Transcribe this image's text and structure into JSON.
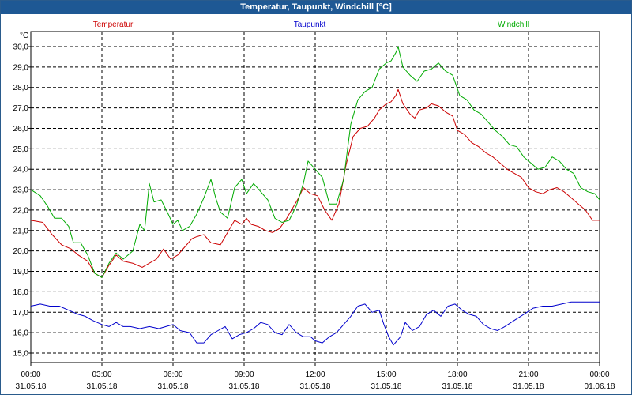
{
  "window": {
    "title": "Temperatur, Taupunkt, Windchill [°C]"
  },
  "chart_data": {
    "type": "line",
    "title": "Temperatur, Taupunkt, Windchill [°C]",
    "ylabel": "°C",
    "ylim": [
      14.6,
      30.6
    ],
    "yticks": [
      "15,0",
      "16,0",
      "17,0",
      "18,0",
      "19,0",
      "20,0",
      "21,0",
      "22,0",
      "23,0",
      "24,0",
      "25,0",
      "26,0",
      "27,0",
      "28,0",
      "29,0",
      "30,0"
    ],
    "ytick_values": [
      15,
      16,
      17,
      18,
      19,
      20,
      21,
      22,
      23,
      24,
      25,
      26,
      27,
      28,
      29,
      30
    ],
    "xlim": [
      0,
      24
    ],
    "xticks": [
      {
        "hour": 0,
        "time": "00:00",
        "date": "31.05.18"
      },
      {
        "hour": 3,
        "time": "03:00",
        "date": "31.05.18"
      },
      {
        "hour": 6,
        "time": "06:00",
        "date": "31.05.18"
      },
      {
        "hour": 9,
        "time": "09:00",
        "date": "31.05.18"
      },
      {
        "hour": 12,
        "time": "12:00",
        "date": "31.05.18"
      },
      {
        "hour": 15,
        "time": "15:00",
        "date": "31.05.18"
      },
      {
        "hour": 18,
        "time": "18:00",
        "date": "31.05.18"
      },
      {
        "hour": 21,
        "time": "21:00",
        "date": "31.05.18"
      },
      {
        "hour": 24,
        "time": "00:00",
        "date": "01.06.18"
      }
    ],
    "grid": true,
    "legend_position": "top",
    "series": [
      {
        "name": "Temperatur",
        "color": "#cc0000",
        "points": [
          [
            0,
            21.5
          ],
          [
            0.5,
            21.4
          ],
          [
            0.9,
            20.8
          ],
          [
            1.3,
            20.3
          ],
          [
            1.7,
            20.1
          ],
          [
            2.0,
            19.8
          ],
          [
            2.4,
            19.5
          ],
          [
            2.7,
            18.9
          ],
          [
            3.0,
            18.7
          ],
          [
            3.3,
            19.3
          ],
          [
            3.6,
            19.8
          ],
          [
            3.9,
            19.5
          ],
          [
            4.3,
            19.4
          ],
          [
            4.7,
            19.2
          ],
          [
            5.0,
            19.4
          ],
          [
            5.3,
            19.6
          ],
          [
            5.6,
            20.1
          ],
          [
            5.9,
            19.6
          ],
          [
            6.2,
            19.8
          ],
          [
            6.5,
            20.2
          ],
          [
            6.8,
            20.6
          ],
          [
            7.0,
            20.7
          ],
          [
            7.3,
            20.8
          ],
          [
            7.6,
            20.4
          ],
          [
            8.0,
            20.3
          ],
          [
            8.3,
            20.9
          ],
          [
            8.6,
            21.5
          ],
          [
            8.9,
            21.3
          ],
          [
            9.1,
            21.6
          ],
          [
            9.3,
            21.3
          ],
          [
            9.6,
            21.2
          ],
          [
            9.9,
            21.0
          ],
          [
            10.2,
            20.9
          ],
          [
            10.5,
            21.1
          ],
          [
            10.8,
            21.6
          ],
          [
            11.1,
            22.2
          ],
          [
            11.3,
            22.6
          ],
          [
            11.5,
            23.1
          ],
          [
            11.8,
            22.8
          ],
          [
            12.1,
            22.7
          ],
          [
            12.4,
            22.0
          ],
          [
            12.7,
            21.5
          ],
          [
            13.0,
            22.3
          ],
          [
            13.3,
            24.2
          ],
          [
            13.6,
            25.6
          ],
          [
            13.9,
            26.0
          ],
          [
            14.2,
            26.1
          ],
          [
            14.5,
            26.5
          ],
          [
            14.7,
            26.9
          ],
          [
            15.0,
            27.2
          ],
          [
            15.2,
            27.3
          ],
          [
            15.4,
            27.6
          ],
          [
            15.5,
            27.9
          ],
          [
            15.7,
            27.2
          ],
          [
            16.0,
            26.7
          ],
          [
            16.2,
            26.5
          ],
          [
            16.4,
            26.9
          ],
          [
            16.7,
            27.0
          ],
          [
            16.9,
            27.2
          ],
          [
            17.2,
            27.1
          ],
          [
            17.5,
            26.8
          ],
          [
            17.8,
            26.6
          ],
          [
            18.0,
            25.9
          ],
          [
            18.3,
            25.7
          ],
          [
            18.6,
            25.3
          ],
          [
            18.9,
            25.1
          ],
          [
            19.2,
            24.8
          ],
          [
            19.5,
            24.6
          ],
          [
            19.8,
            24.3
          ],
          [
            20.1,
            24.0
          ],
          [
            20.4,
            23.8
          ],
          [
            20.7,
            23.6
          ],
          [
            21.0,
            23.1
          ],
          [
            21.3,
            22.9
          ],
          [
            21.6,
            22.8
          ],
          [
            21.9,
            23.0
          ],
          [
            22.2,
            23.1
          ],
          [
            22.5,
            22.9
          ],
          [
            22.8,
            22.6
          ],
          [
            23.1,
            22.3
          ],
          [
            23.4,
            22.0
          ],
          [
            23.7,
            21.5
          ],
          [
            24.0,
            21.5
          ]
        ]
      },
      {
        "name": "Taupunkt",
        "color": "#0000cc",
        "points": [
          [
            0,
            17.3
          ],
          [
            0.4,
            17.4
          ],
          [
            0.8,
            17.3
          ],
          [
            1.2,
            17.3
          ],
          [
            1.6,
            17.1
          ],
          [
            2.0,
            16.9
          ],
          [
            2.3,
            16.8
          ],
          [
            2.6,
            16.6
          ],
          [
            3.0,
            16.4
          ],
          [
            3.3,
            16.3
          ],
          [
            3.6,
            16.5
          ],
          [
            3.9,
            16.3
          ],
          [
            4.2,
            16.3
          ],
          [
            4.6,
            16.2
          ],
          [
            5.0,
            16.3
          ],
          [
            5.4,
            16.2
          ],
          [
            5.7,
            16.3
          ],
          [
            6.0,
            16.4
          ],
          [
            6.3,
            16.1
          ],
          [
            6.7,
            16.0
          ],
          [
            7.0,
            15.5
          ],
          [
            7.3,
            15.5
          ],
          [
            7.6,
            15.9
          ],
          [
            7.9,
            16.1
          ],
          [
            8.2,
            16.3
          ],
          [
            8.5,
            15.7
          ],
          [
            8.8,
            15.9
          ],
          [
            9.1,
            16.0
          ],
          [
            9.4,
            16.2
          ],
          [
            9.7,
            16.5
          ],
          [
            10.0,
            16.4
          ],
          [
            10.3,
            16.0
          ],
          [
            10.6,
            15.9
          ],
          [
            10.9,
            16.4
          ],
          [
            11.2,
            16.0
          ],
          [
            11.5,
            15.8
          ],
          [
            11.8,
            15.8
          ],
          [
            12.0,
            15.6
          ],
          [
            12.3,
            15.5
          ],
          [
            12.6,
            15.8
          ],
          [
            12.9,
            16.0
          ],
          [
            13.2,
            16.4
          ],
          [
            13.5,
            16.8
          ],
          [
            13.8,
            17.3
          ],
          [
            14.1,
            17.4
          ],
          [
            14.4,
            17.0
          ],
          [
            14.7,
            17.1
          ],
          [
            14.9,
            16.4
          ],
          [
            15.1,
            15.8
          ],
          [
            15.3,
            15.4
          ],
          [
            15.6,
            15.8
          ],
          [
            15.8,
            16.5
          ],
          [
            16.1,
            16.1
          ],
          [
            16.4,
            16.3
          ],
          [
            16.7,
            16.9
          ],
          [
            17.0,
            17.1
          ],
          [
            17.3,
            16.8
          ],
          [
            17.6,
            17.3
          ],
          [
            17.9,
            17.4
          ],
          [
            18.2,
            17.1
          ],
          [
            18.5,
            16.9
          ],
          [
            18.8,
            16.8
          ],
          [
            19.1,
            16.4
          ],
          [
            19.4,
            16.2
          ],
          [
            19.7,
            16.1
          ],
          [
            20.0,
            16.3
          ],
          [
            20.4,
            16.6
          ],
          [
            20.8,
            16.9
          ],
          [
            21.2,
            17.2
          ],
          [
            21.6,
            17.3
          ],
          [
            22.0,
            17.3
          ],
          [
            22.4,
            17.4
          ],
          [
            22.8,
            17.5
          ],
          [
            23.2,
            17.5
          ],
          [
            23.6,
            17.5
          ],
          [
            24.0,
            17.5
          ]
        ]
      },
      {
        "name": "Windchill",
        "color": "#00aa00",
        "points": [
          [
            0,
            23.0
          ],
          [
            0.4,
            22.7
          ],
          [
            0.7,
            22.2
          ],
          [
            1.0,
            21.6
          ],
          [
            1.3,
            21.6
          ],
          [
            1.6,
            21.2
          ],
          [
            1.8,
            20.4
          ],
          [
            2.1,
            20.4
          ],
          [
            2.4,
            19.8
          ],
          [
            2.7,
            18.9
          ],
          [
            3.0,
            18.7
          ],
          [
            3.3,
            19.4
          ],
          [
            3.6,
            19.9
          ],
          [
            3.9,
            19.6
          ],
          [
            4.3,
            20.0
          ],
          [
            4.6,
            21.3
          ],
          [
            4.8,
            21.0
          ],
          [
            5.0,
            23.3
          ],
          [
            5.2,
            22.4
          ],
          [
            5.5,
            22.5
          ],
          [
            5.8,
            21.8
          ],
          [
            6.0,
            21.3
          ],
          [
            6.2,
            21.5
          ],
          [
            6.4,
            21.0
          ],
          [
            6.7,
            21.2
          ],
          [
            7.0,
            21.8
          ],
          [
            7.3,
            22.6
          ],
          [
            7.6,
            23.5
          ],
          [
            7.8,
            22.6
          ],
          [
            8.0,
            21.9
          ],
          [
            8.3,
            21.6
          ],
          [
            8.6,
            23.1
          ],
          [
            8.9,
            23.5
          ],
          [
            9.1,
            22.8
          ],
          [
            9.4,
            23.3
          ],
          [
            9.7,
            22.9
          ],
          [
            10.0,
            22.5
          ],
          [
            10.3,
            21.6
          ],
          [
            10.6,
            21.4
          ],
          [
            10.9,
            21.5
          ],
          [
            11.2,
            22.2
          ],
          [
            11.5,
            23.3
          ],
          [
            11.7,
            24.4
          ],
          [
            12.0,
            24.0
          ],
          [
            12.3,
            23.6
          ],
          [
            12.6,
            22.3
          ],
          [
            12.9,
            22.3
          ],
          [
            13.2,
            23.5
          ],
          [
            13.5,
            26.2
          ],
          [
            13.8,
            27.4
          ],
          [
            14.1,
            27.8
          ],
          [
            14.4,
            28.0
          ],
          [
            14.7,
            28.9
          ],
          [
            15.0,
            29.2
          ],
          [
            15.2,
            29.3
          ],
          [
            15.4,
            29.7
          ],
          [
            15.5,
            30.0
          ],
          [
            15.7,
            29.0
          ],
          [
            16.0,
            28.6
          ],
          [
            16.3,
            28.3
          ],
          [
            16.6,
            28.8
          ],
          [
            16.9,
            28.9
          ],
          [
            17.2,
            29.2
          ],
          [
            17.5,
            28.8
          ],
          [
            17.8,
            28.6
          ],
          [
            18.1,
            27.6
          ],
          [
            18.4,
            27.4
          ],
          [
            18.7,
            26.9
          ],
          [
            19.0,
            26.7
          ],
          [
            19.3,
            26.3
          ],
          [
            19.6,
            25.9
          ],
          [
            19.9,
            25.6
          ],
          [
            20.2,
            25.2
          ],
          [
            20.5,
            25.1
          ],
          [
            20.8,
            24.6
          ],
          [
            21.1,
            24.3
          ],
          [
            21.4,
            24.0
          ],
          [
            21.7,
            24.1
          ],
          [
            22.0,
            24.6
          ],
          [
            22.3,
            24.4
          ],
          [
            22.6,
            24.0
          ],
          [
            22.9,
            23.8
          ],
          [
            23.2,
            23.1
          ],
          [
            23.5,
            22.9
          ],
          [
            23.8,
            22.8
          ],
          [
            24.0,
            22.5
          ]
        ]
      }
    ]
  }
}
